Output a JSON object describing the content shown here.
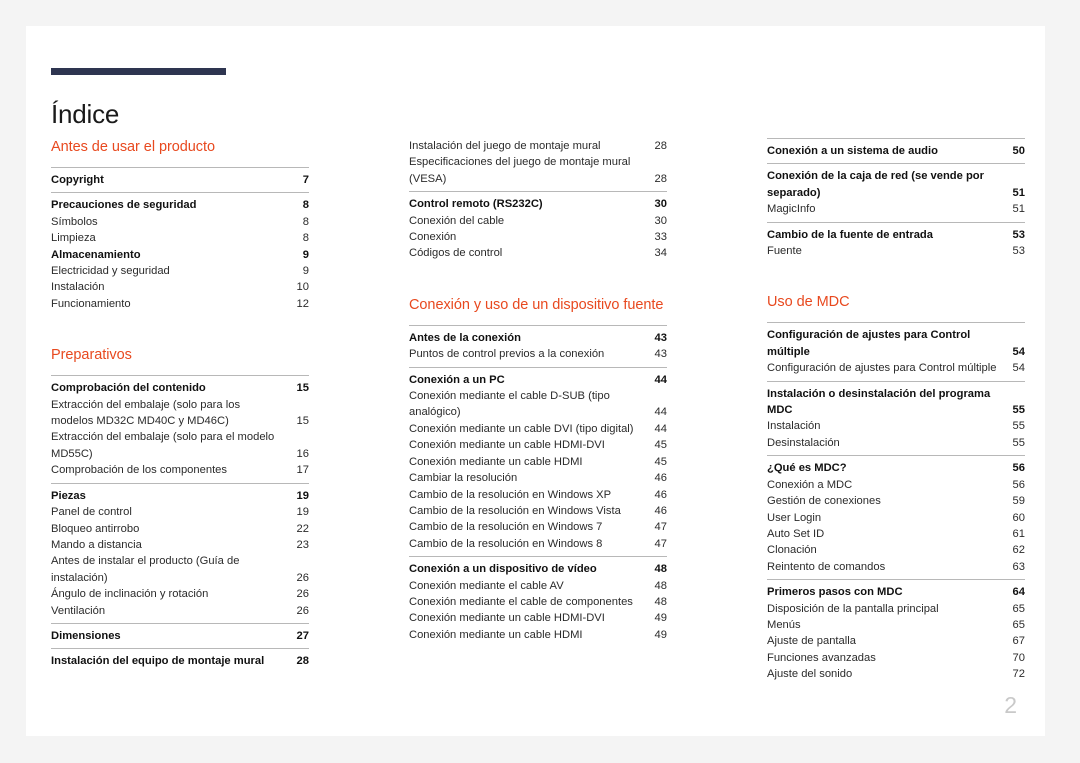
{
  "document": {
    "title": "Índice",
    "folio": "2",
    "accent_color": "#e8491f",
    "rule_color": "#2e3550",
    "page_background": "#ffffff",
    "canvas_background": "#f4f4f4"
  },
  "columns": [
    {
      "id": "column-1",
      "blocks": [
        {
          "type": "heading",
          "text": "Antes de usar el producto"
        },
        {
          "type": "group",
          "entries": [
            {
              "label": "Copyright",
              "page": "7",
              "bold": true
            }
          ]
        },
        {
          "type": "group",
          "entries": [
            {
              "label": "Precauciones de seguridad",
              "page": "8",
              "bold": true
            },
            {
              "label": "Símbolos",
              "page": "8",
              "bold": false
            },
            {
              "label": "Limpieza",
              "page": "8",
              "bold": false
            },
            {
              "label": "Almacenamiento",
              "page": "9",
              "bold": true
            },
            {
              "label": "Electricidad y seguridad",
              "page": "9",
              "bold": false
            },
            {
              "label": "Instalación",
              "page": "10",
              "bold": false
            },
            {
              "label": "Funcionamiento",
              "page": "12",
              "bold": false
            }
          ]
        },
        {
          "type": "gap"
        },
        {
          "type": "heading",
          "text": "Preparativos"
        },
        {
          "type": "group",
          "entries": [
            {
              "label": "Comprobación del contenido",
              "page": "15",
              "bold": true
            },
            {
              "label": "Extracción del embalaje (solo para los modelos MD32C MD40C y MD46C)",
              "page": "15",
              "bold": false
            },
            {
              "label": "Extracción del embalaje (solo para el modelo MD55C)",
              "page": "16",
              "bold": false
            },
            {
              "label": "Comprobación de los componentes",
              "page": "17",
              "bold": false
            }
          ]
        },
        {
          "type": "group",
          "entries": [
            {
              "label": "Piezas",
              "page": "19",
              "bold": true
            },
            {
              "label": "Panel de control",
              "page": "19",
              "bold": false
            },
            {
              "label": "Bloqueo antirrobo",
              "page": "22",
              "bold": false
            },
            {
              "label": "Mando a distancia",
              "page": "23",
              "bold": false
            },
            {
              "label": "Antes de instalar el producto (Guía de instalación)",
              "page": "26",
              "bold": false
            },
            {
              "label": "Ángulo de inclinación y rotación",
              "page": "26",
              "bold": false
            },
            {
              "label": "Ventilación",
              "page": "26",
              "bold": false
            }
          ]
        },
        {
          "type": "group",
          "entries": [
            {
              "label": "Dimensiones",
              "page": "27",
              "bold": true
            }
          ]
        },
        {
          "type": "group",
          "entries": [
            {
              "label": "Instalación del equipo de montaje mural",
              "page": "28",
              "bold": true
            }
          ]
        }
      ]
    },
    {
      "id": "column-2",
      "blocks": [
        {
          "type": "group",
          "no_rule": true,
          "entries": [
            {
              "label": "Instalación del juego de montaje mural",
              "page": "28",
              "bold": false
            },
            {
              "label": "Especificaciones del juego de montaje mural (VESA)",
              "page": "28",
              "bold": false
            }
          ]
        },
        {
          "type": "group",
          "entries": [
            {
              "label": "Control remoto (RS232C)",
              "page": "30",
              "bold": true
            },
            {
              "label": "Conexión del cable",
              "page": "30",
              "bold": false
            },
            {
              "label": "Conexión",
              "page": "33",
              "bold": false
            },
            {
              "label": "Códigos de control",
              "page": "34",
              "bold": false
            }
          ]
        },
        {
          "type": "gap"
        },
        {
          "type": "heading",
          "text": "Conexión y uso de un dispositivo fuente"
        },
        {
          "type": "group",
          "entries": [
            {
              "label": "Antes de la conexión",
              "page": "43",
              "bold": true
            },
            {
              "label": "Puntos de control previos a la conexión",
              "page": "43",
              "bold": false
            }
          ]
        },
        {
          "type": "group",
          "entries": [
            {
              "label": "Conexión a un PC",
              "page": "44",
              "bold": true
            },
            {
              "label": "Conexión mediante el cable D-SUB (tipo analógico)",
              "page": "44",
              "bold": false
            },
            {
              "label": "Conexión mediante un cable DVI (tipo digital)",
              "page": "44",
              "bold": false
            },
            {
              "label": "Conexión mediante un cable HDMI-DVI",
              "page": "45",
              "bold": false
            },
            {
              "label": "Conexión mediante un cable HDMI",
              "page": "45",
              "bold": false
            },
            {
              "label": "Cambiar la resolución",
              "page": "46",
              "bold": false
            },
            {
              "label": "Cambio de la resolución en Windows XP",
              "page": "46",
              "bold": false
            },
            {
              "label": "Cambio de la resolución en Windows Vista",
              "page": "46",
              "bold": false
            },
            {
              "label": "Cambio de la resolución en Windows 7",
              "page": "47",
              "bold": false
            },
            {
              "label": "Cambio de la resolución en Windows 8",
              "page": "47",
              "bold": false
            }
          ]
        },
        {
          "type": "group",
          "entries": [
            {
              "label": "Conexión a un dispositivo de vídeo",
              "page": "48",
              "bold": true
            },
            {
              "label": "Conexión mediante el cable AV",
              "page": "48",
              "bold": false
            },
            {
              "label": "Conexión mediante el cable de componentes",
              "page": "48",
              "bold": false
            },
            {
              "label": "Conexión mediante un cable HDMI-DVI",
              "page": "49",
              "bold": false
            },
            {
              "label": "Conexión mediante un cable HDMI",
              "page": "49",
              "bold": false
            }
          ]
        }
      ]
    },
    {
      "id": "column-3",
      "blocks": [
        {
          "type": "group",
          "entries": [
            {
              "label": "Conexión a un sistema de audio",
              "page": "50",
              "bold": true
            }
          ]
        },
        {
          "type": "group",
          "entries": [
            {
              "label": "Conexión de la caja de red (se vende por separado)",
              "page": "51",
              "bold": true
            },
            {
              "label": "MagicInfo",
              "page": "51",
              "bold": false
            }
          ]
        },
        {
          "type": "group",
          "entries": [
            {
              "label": "Cambio de la fuente de entrada",
              "page": "53",
              "bold": true
            },
            {
              "label": "Fuente",
              "page": "53",
              "bold": false
            }
          ]
        },
        {
          "type": "gap"
        },
        {
          "type": "heading",
          "text": "Uso de MDC"
        },
        {
          "type": "group",
          "entries": [
            {
              "label": "Configuración de ajustes para Control múltiple",
              "page": "54",
              "bold": true
            },
            {
              "label": "Configuración de ajustes para Control múltiple",
              "page": "54",
              "bold": false
            }
          ]
        },
        {
          "type": "group",
          "entries": [
            {
              "label": "Instalación o desinstalación del programa MDC",
              "page": "55",
              "bold": true
            },
            {
              "label": "Instalación",
              "page": "55",
              "bold": false
            },
            {
              "label": "Desinstalación",
              "page": "55",
              "bold": false
            }
          ]
        },
        {
          "type": "group",
          "entries": [
            {
              "label": "¿Qué es MDC?",
              "page": "56",
              "bold": true
            },
            {
              "label": "Conexión a MDC",
              "page": "56",
              "bold": false
            },
            {
              "label": "Gestión de conexiones",
              "page": "59",
              "bold": false
            },
            {
              "label": "User Login",
              "page": "60",
              "bold": false
            },
            {
              "label": "Auto Set ID",
              "page": "61",
              "bold": false
            },
            {
              "label": "Clonación",
              "page": "62",
              "bold": false
            },
            {
              "label": "Reintento de comandos",
              "page": "63",
              "bold": false
            }
          ]
        },
        {
          "type": "group",
          "entries": [
            {
              "label": "Primeros pasos con MDC",
              "page": "64",
              "bold": true
            },
            {
              "label": "Disposición de la pantalla principal",
              "page": "65",
              "bold": false
            },
            {
              "label": "Menús",
              "page": "65",
              "bold": false
            },
            {
              "label": "Ajuste de pantalla",
              "page": "67",
              "bold": false
            },
            {
              "label": "Funciones avanzadas",
              "page": "70",
              "bold": false
            },
            {
              "label": "Ajuste del sonido",
              "page": "72",
              "bold": false
            }
          ]
        }
      ]
    }
  ]
}
